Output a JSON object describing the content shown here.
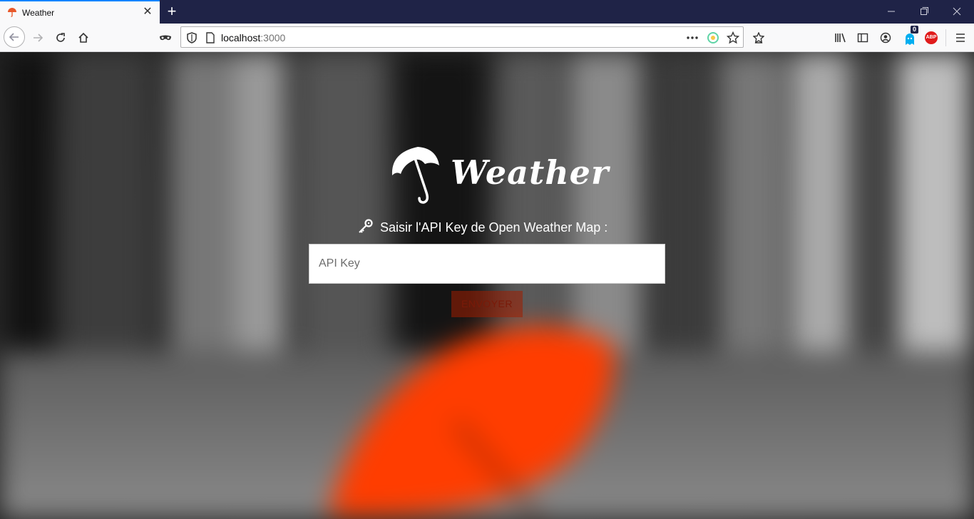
{
  "browser": {
    "tab": {
      "title": "Weather"
    },
    "url": {
      "host": "localhost",
      "port": ":3000"
    },
    "badge_count": "0",
    "abp_label": "ABP"
  },
  "page": {
    "brand": "Weather",
    "prompt": "Saisir l'API Key de Open Weather Map :",
    "input": {
      "placeholder": "API Key",
      "value": ""
    },
    "submit_label": "ENVOYER",
    "accent_color": "#ff3d00"
  },
  "icons": [
    "umbrella-favicon-icon",
    "close-icon",
    "plus-icon",
    "minimize-icon",
    "restore-icon",
    "window-close-icon",
    "back-icon",
    "forward-icon",
    "reload-icon",
    "home-icon",
    "mask-icon",
    "shield-icon",
    "page-icon",
    "more-icon",
    "extension-icon",
    "star-icon",
    "pocket-icon",
    "library-icon",
    "sidebar-icon",
    "account-icon",
    "ghostery-icon",
    "adblock-icon",
    "menu-icon",
    "umbrella-logo-icon",
    "key-icon"
  ]
}
